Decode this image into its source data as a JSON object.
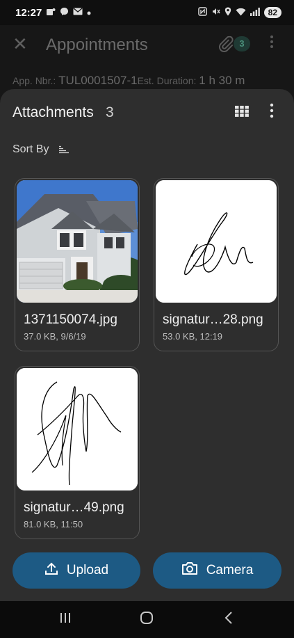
{
  "status_bar": {
    "time": "12:27",
    "battery": "82",
    "icons": [
      "teams-icon",
      "messenger-icon",
      "mail-icon",
      "dot-icon",
      "nfc-icon",
      "mute-icon",
      "location-icon",
      "wifi-icon",
      "signal-icon"
    ]
  },
  "app_bar": {
    "title": "Appointments",
    "attachment_badge": "3",
    "icons": [
      "close-icon",
      "paperclip-icon",
      "more-vertical-icon"
    ]
  },
  "appointment_info": {
    "app_nbr_label": "App. Nbr.:",
    "app_nbr_value": "TUL0001507-1",
    "duration_label": "Est. Duration:",
    "duration_value": "1 h 30 m"
  },
  "sheet": {
    "title": "Attachments",
    "count": "3",
    "sort_label": "Sort By",
    "icons": [
      "grid-view-icon",
      "more-vertical-icon",
      "sort-icon"
    ]
  },
  "attachments": [
    {
      "name": "1371150074.jpg",
      "meta": "37.0 KB, 9/6/19",
      "thumb": "house-photo"
    },
    {
      "name": "signatur…28.png",
      "meta": "53.0 KB, 12:19",
      "thumb": "signature"
    },
    {
      "name": "signatur…49.png",
      "meta": "81.0 KB, 11:50",
      "thumb": "signature"
    }
  ],
  "actions": {
    "upload_label": "Upload",
    "camera_label": "Camera",
    "accent": "#1d5a84"
  },
  "nav_bar": {
    "icons": [
      "recents-icon",
      "home-icon",
      "back-icon"
    ]
  },
  "colors": {
    "sheet_bg": "#2e2e2e",
    "card_border": "#555555"
  }
}
